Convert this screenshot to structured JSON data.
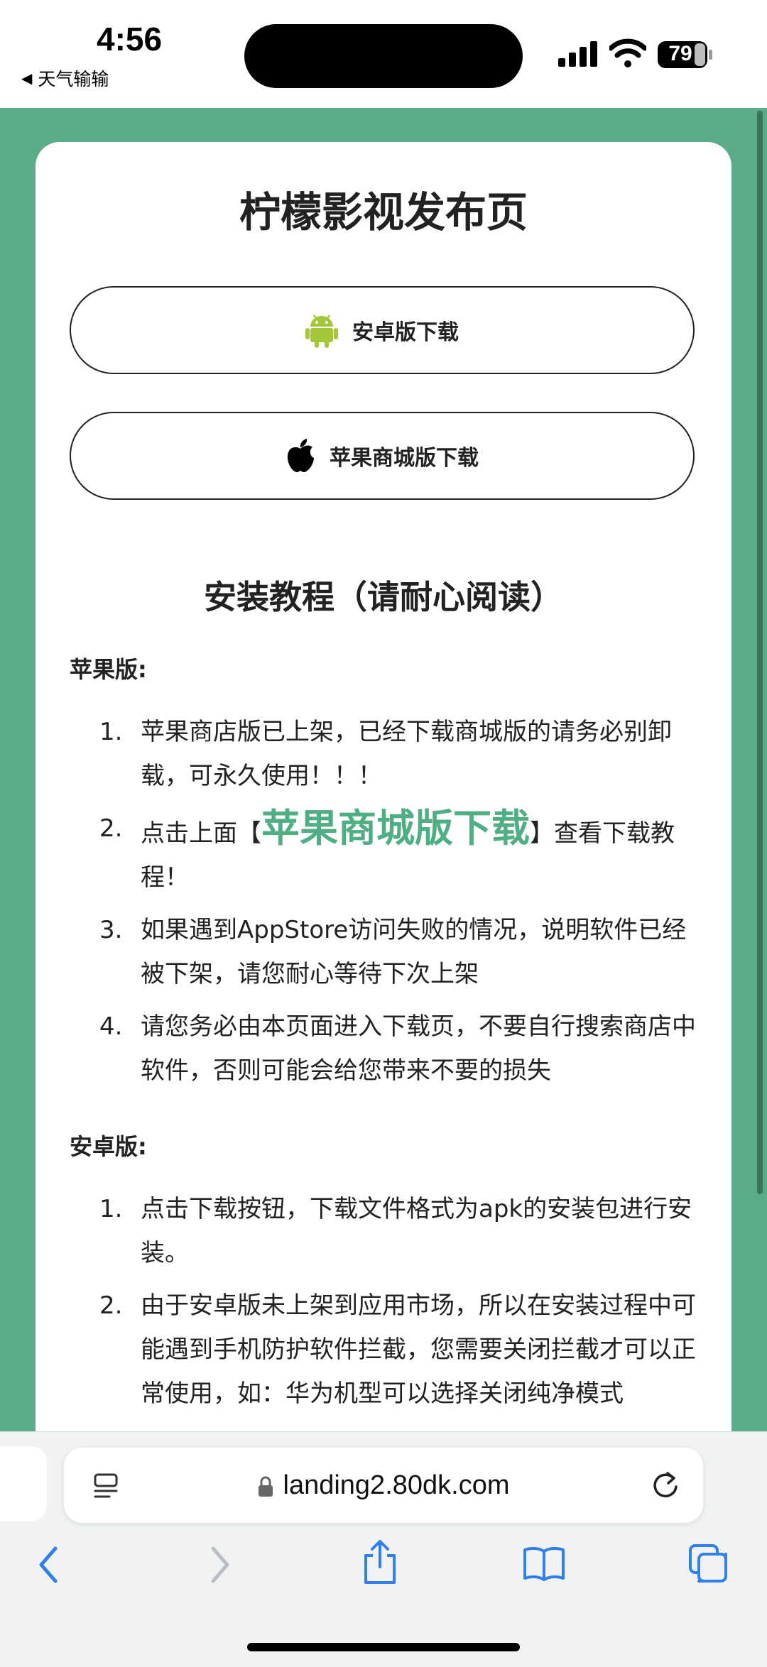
{
  "status_bar": {
    "time": "4:56",
    "back_app": "天气输输",
    "battery": "79"
  },
  "page": {
    "title": "柠檬影视发布页",
    "android_button": "安卓版下载",
    "apple_button": "苹果商城版下载",
    "tutorial_title": "安装教程（请耐心阅读）",
    "apple_section": {
      "label": "苹果版:",
      "items": [
        {
          "num": "1.",
          "text": "苹果商店版已上架，已经下载商城版的请务必别卸载，可永久使用！！！"
        },
        {
          "num": "2.",
          "pre": "点击上面【",
          "highlight": "苹果商城版下载",
          "post": "】查看下载教程！"
        },
        {
          "num": "3.",
          "text": "如果遇到AppStore访问失败的情况，说明软件已经被下架，请您耐心等待下次上架"
        },
        {
          "num": "4.",
          "text": "请您务必由本页面进入下载页，不要自行搜索商店中软件，否则可能会给您带来不要的损失"
        }
      ]
    },
    "android_section": {
      "label": "安卓版:",
      "items": [
        {
          "num": "1.",
          "text": "点击下载按钮，下载文件格式为apk的安装包进行安装。"
        },
        {
          "num": "2.",
          "text": "由于安卓版未上架到应用市场，所以在安装过程中可能遇到手机防护软件拦截，您需要关闭拦截才可以正常使用，如：华为机型可以选择关闭纯净模式"
        }
      ]
    }
  },
  "browser": {
    "url": "landing2.80dk.com"
  },
  "colors": {
    "background": "#5aac86",
    "highlight": "#4fae84",
    "android_green": "#a4c639"
  },
  "icons": [
    "android-icon",
    "apple-icon",
    "lock-icon",
    "reader-icon",
    "reload-icon",
    "back-icon",
    "forward-icon",
    "share-icon",
    "bookmarks-icon",
    "tabs-icon"
  ]
}
